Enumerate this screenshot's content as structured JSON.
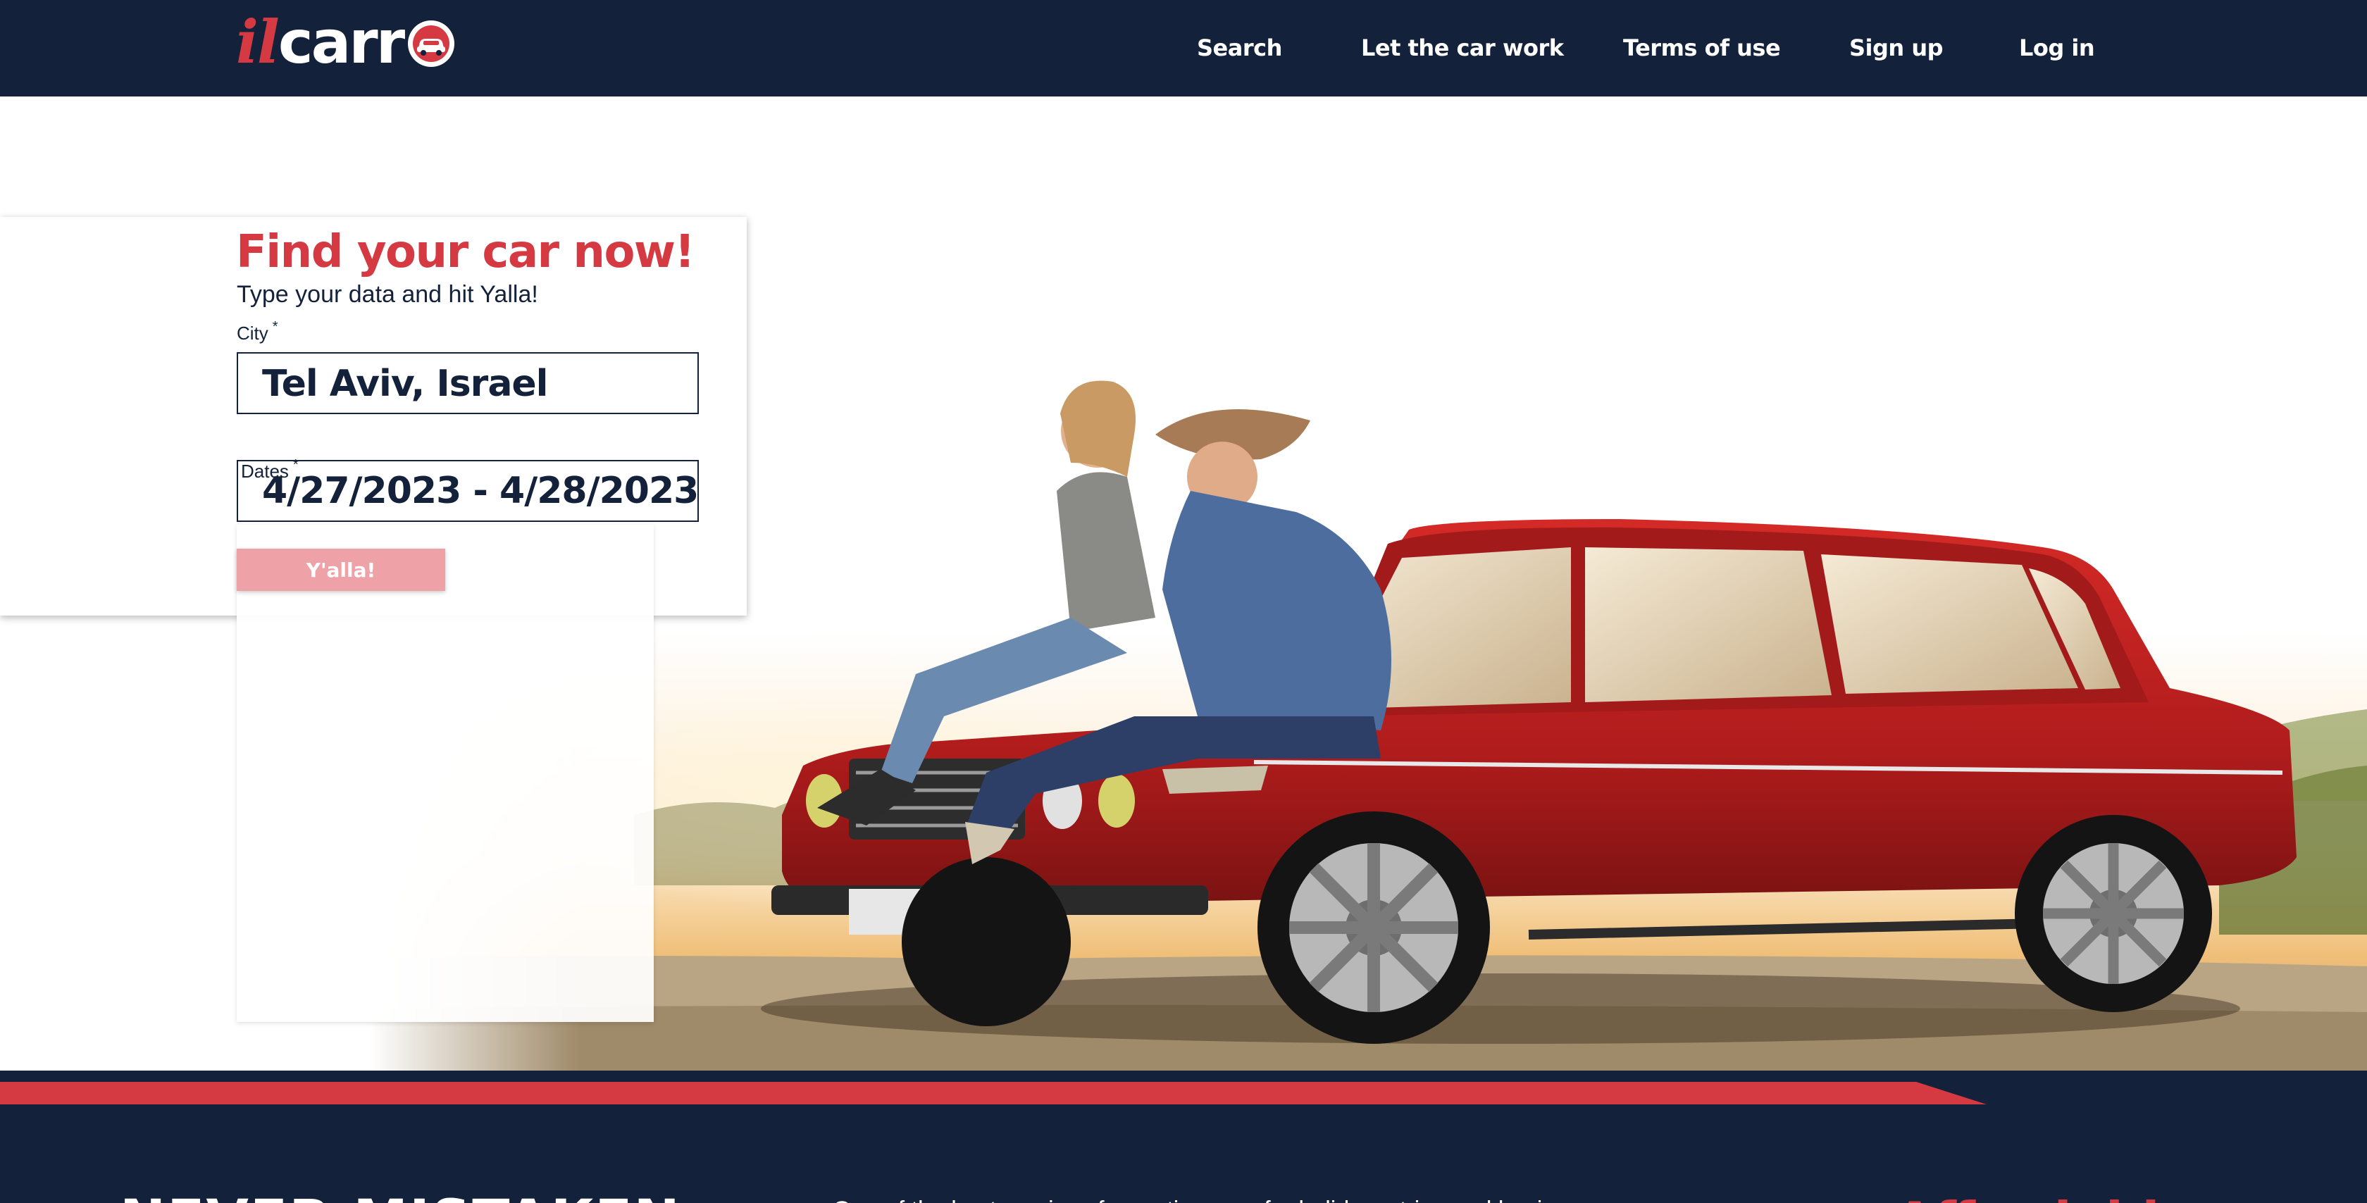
{
  "header": {
    "logo": {
      "prefix": "il",
      "main": "carr"
    },
    "nav": [
      {
        "label": "Search"
      },
      {
        "label": "Let the car work"
      },
      {
        "label": "Terms of use"
      },
      {
        "label": "Sign up"
      },
      {
        "label": "Log in"
      }
    ]
  },
  "search_card": {
    "title": "Find your car now!",
    "subtitle": "Type your data and hit Yalla!",
    "city": {
      "label": "City",
      "required_mark": "*",
      "value": "Tel Aviv, Israel"
    },
    "dates": {
      "label": "Dates",
      "required_mark": "*",
      "value": "4/27/2023 - 4/28/2023"
    },
    "submit_label": "Y'alla!"
  },
  "hero": {
    "image_description": "couple sitting on red vintage car hood"
  },
  "colors": {
    "navy": "#13223a",
    "accent_red": "#d53a43",
    "button_pink": "#eea1a6",
    "white": "#ffffff"
  },
  "footer_section": {
    "heading": "NEVER MISTAKEN",
    "text": "One of the best services for renting cars for holidays, trips and business",
    "accent": "Affordable"
  },
  "icons": [
    "car-logo-icon"
  ]
}
